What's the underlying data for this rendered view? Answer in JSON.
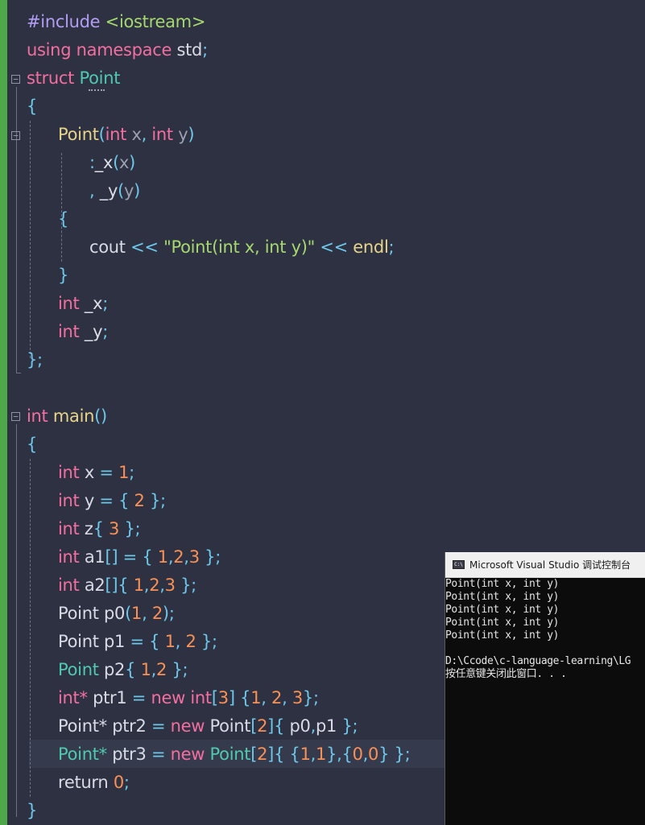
{
  "code": {
    "l1": [
      "#include ",
      "<iostream>"
    ],
    "l2": [
      "using",
      " ",
      "namespace",
      " ",
      "std",
      ";"
    ],
    "l3": [
      "struct",
      " ",
      "Point"
    ],
    "l4": "{",
    "l5": [
      "Point",
      "(",
      "int",
      " ",
      "x",
      ", ",
      "int",
      " ",
      "y",
      ")"
    ],
    "l6": [
      ":",
      "_x",
      "(",
      "x",
      ")"
    ],
    "l7": [
      ", ",
      "_y",
      "(",
      "y",
      ")"
    ],
    "l8": "{",
    "l9": [
      "cout",
      " << ",
      "\"Point(int x, int y)\"",
      " << ",
      "endl",
      ";"
    ],
    "l10": "}",
    "l11": [
      "int",
      " ",
      "_x",
      ";"
    ],
    "l12": [
      "int",
      " ",
      "_y",
      ";"
    ],
    "l13": "};",
    "l15": [
      "int",
      " ",
      "main",
      "()"
    ],
    "l16": "{",
    "l17": [
      "int",
      " x ",
      "=",
      " ",
      "1",
      ";"
    ],
    "l18": [
      "int",
      " y ",
      "=",
      " ",
      "{ ",
      "2",
      " }",
      ";"
    ],
    "l19": [
      "int",
      " z",
      "{ ",
      "3",
      " }",
      ";"
    ],
    "l20": [
      "int",
      " a1",
      "[]",
      " = ",
      "{ ",
      "1",
      ",",
      "2",
      ",",
      "3",
      " }",
      ";"
    ],
    "l21": [
      "int",
      " a2",
      "[]",
      "{ ",
      "1",
      ",",
      "2",
      ",",
      "3",
      " }",
      ";"
    ],
    "l22": [
      "Point",
      " p0",
      "(",
      "1",
      ", ",
      "2",
      ")",
      ";"
    ],
    "l23": [
      "Point",
      " p1 ",
      "=",
      " { ",
      "1",
      ", ",
      "2",
      " }",
      ";"
    ],
    "l24": [
      "Point",
      " p2",
      "{ ",
      "1",
      ",",
      "2",
      " }",
      ";"
    ],
    "l25": [
      "int*",
      " ptr1 ",
      "=",
      " ",
      "new",
      " ",
      "int",
      "[",
      "3",
      "]",
      " {",
      "1",
      ", ",
      "2",
      ", ",
      "3",
      "}",
      ";"
    ],
    "l26": [
      "Point*",
      " ptr2 ",
      "=",
      " ",
      "new",
      " ",
      "Point",
      "[",
      "2",
      "]",
      "{",
      " p0",
      ",",
      "p1",
      " }",
      ";"
    ],
    "l27": [
      "Point*",
      " ptr3 ",
      "=",
      " ",
      "new",
      " ",
      "Point",
      "[",
      "2",
      "]",
      "{",
      " {",
      "1",
      ",",
      "1",
      "}",
      ",{",
      "0",
      ",",
      "0",
      "}",
      " }",
      ";"
    ],
    "l28": [
      "return",
      " ",
      "0",
      ";"
    ],
    "l29": "}",
    "fold_glyph": "−"
  },
  "console": {
    "icon_text": "C:\\",
    "title": "Microsoft Visual Studio 调试控制台",
    "lines": [
      "Point(int x, int y)",
      "Point(int x, int y)",
      "Point(int x, int y)",
      "Point(int x, int y)",
      "Point(int x, int y)",
      "",
      "D:\\Ccode\\c-language-learning\\LG",
      "按任意键关闭此窗口. . ."
    ]
  },
  "colors": {
    "background": "#2d3142",
    "keyword": "#f36fa0",
    "type": "#4fc9b0",
    "function": "#e6d48a",
    "number": "#f99157",
    "string": "#a6d86f",
    "change_bar": "#4ea84a"
  }
}
